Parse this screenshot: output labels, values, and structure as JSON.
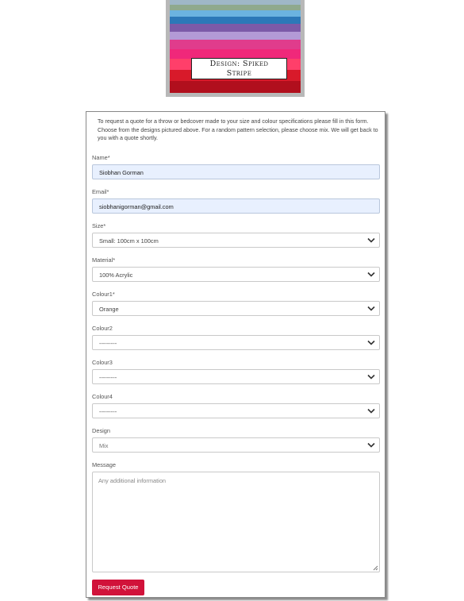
{
  "design": {
    "label_line1": "Design: Spiked",
    "label_line2": "Stripe"
  },
  "form": {
    "intro": "To request a quote for a throw or bedcover made to your size and colour specifications please fill in this form. Choose from the designs pictured above. For a random pattern selection, please choose mix. We will get back to you with a quote shortly.",
    "name": {
      "label": "Name*",
      "value": "Siobhan Gorman"
    },
    "email": {
      "label": "Email*",
      "value": "siobhanigorman@gmail.com"
    },
    "size": {
      "label": "Size*",
      "value": "Small: 100cm x 100cm"
    },
    "material": {
      "label": "Material*",
      "value": "100% Acrylic"
    },
    "colour1": {
      "label": "Colour1*",
      "value": "Orange"
    },
    "colour2": {
      "label": "Colour2",
      "value": "---------"
    },
    "colour3": {
      "label": "Colour3",
      "value": "---------"
    },
    "colour4": {
      "label": "Colour4",
      "value": "---------"
    },
    "design_field": {
      "label": "Design",
      "value": "Mix"
    },
    "message": {
      "label": "Message",
      "placeholder": "Any additional information"
    },
    "submit_label": "Request Quote"
  },
  "colors": {
    "button": "#d1123a",
    "autofill": "#e8f0fe"
  },
  "icons": {
    "select_arrow": "chevron-down-icon",
    "textarea_resize": "resize-handle-icon"
  }
}
